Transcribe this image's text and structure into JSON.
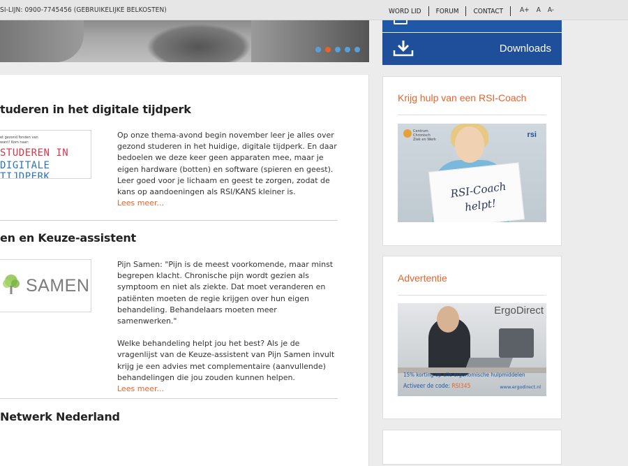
{
  "topbar": {
    "hotline": "SI-LIJN: 0900-7745456 (GEBRUIKELIJKE BELKOSTEN)",
    "nav": [
      {
        "label": "WORD LID"
      },
      {
        "label": "FORUM"
      },
      {
        "label": "CONTACT"
      }
    ],
    "font_sizes": [
      "A+",
      "A",
      "A-"
    ]
  },
  "hero": {
    "slides": 5,
    "active_slide": 2
  },
  "sidebar_buttons": {
    "downloads": "Downloads"
  },
  "articles": [
    {
      "title": "tuderen in het digitale tijdperk",
      "thumb_small": "et gezond fonden van\nwant! Kom naar:",
      "thumb_line1": "STUDEREN IN",
      "thumb_line2": "DIGITALE TIJDPERK",
      "body": "Op onze thema-avond begin november leer je alles over gezond studeren in het huidige, digitale tijdperk. En daar bedoelen we deze keer geen apparaten mee, maar je eigen hardware (botten) en software (spieren en geest). Leer goed voor je lichaam en geest te zorgen, zodat de kans op aandoeningen als RSI/KANS kleiner is.",
      "read_more": "Lees meer..."
    },
    {
      "title": "en en Keuze-assistent",
      "thumb_text": "SAMEN",
      "body1": "Pijn Samen: \"Pijn is de meest voorkomende, maar minst begrepen klacht. Chronische pijn wordt gezien als symptoom en niet als ziekte. Dat moet veranderen en patiënten moeten de regie krijgen over hun eigen behandeling. Behandelaars moeten meer samenwerken.\"",
      "body2": "Welke behandeling helpt jou het best? Als je de vragenlijst van de Keuze-assistent van Pijn Samen invult krijg je een advies met complementaire (aanvullende) behandelingen die jou zouden kunnen helpen.",
      "read_more": "Lees meer..."
    },
    {
      "title": "Netwerk Nederland"
    }
  ],
  "sidebar": {
    "coach": {
      "heading": "Krijg hulp van een RSI-Coach",
      "sign_text": "RSI-Coach helpt!",
      "logo_left": "Centrum\nChronisch\nZiek en Werk",
      "logo_right": "rsi"
    },
    "ad": {
      "heading": "Advertentie",
      "brand": "ErgoDirect",
      "promo": "15% korting op alle ergonomische hulpmiddelen",
      "activate": "Activeer de code: ",
      "code": "RSI345",
      "url": "www.ergodirect.nl"
    }
  },
  "colors": {
    "accent": "#e8632a",
    "blue": "#1f4e9a",
    "dot": "#5aa0d8"
  }
}
